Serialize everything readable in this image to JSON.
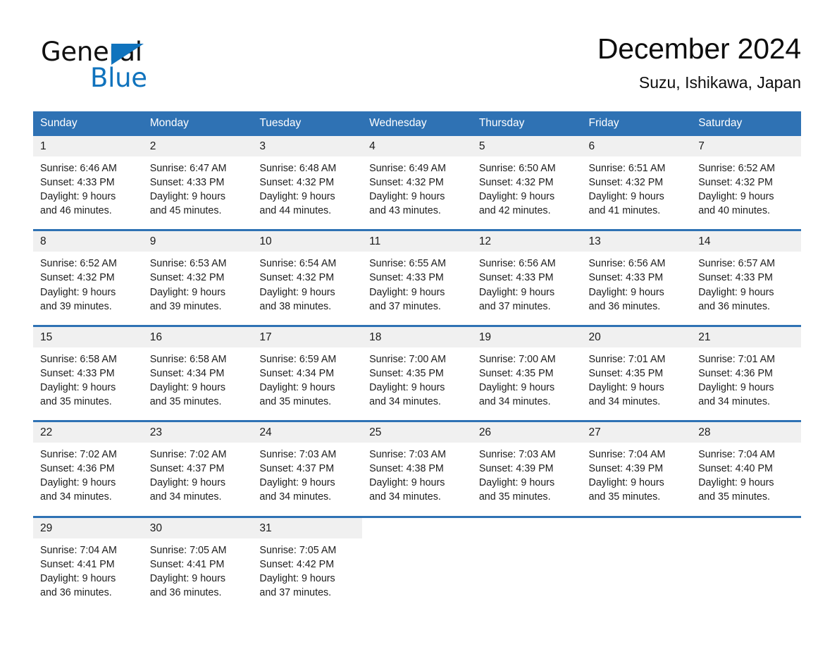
{
  "brand": {
    "word_one": "General",
    "word_two": "Blue",
    "triangle_icon": "triangle-icon",
    "colors": {
      "blue": "#1073bd",
      "black": "#101010"
    }
  },
  "header": {
    "title": "December 2024",
    "subtitle": "Suzu, Ishikawa, Japan"
  },
  "theme": {
    "header_blue": "#2f72b4",
    "daynum_gray": "#f0f0f0",
    "rule_blue": "#2f72b4"
  },
  "weekday_headers": [
    "Sunday",
    "Monday",
    "Tuesday",
    "Wednesday",
    "Thursday",
    "Friday",
    "Saturday"
  ],
  "weeks": [
    {
      "days": [
        {
          "num": "1",
          "sunrise": "Sunrise: 6:46 AM",
          "sunset": "Sunset: 4:33 PM",
          "daylight1": "Daylight: 9 hours",
          "daylight2": "and 46 minutes."
        },
        {
          "num": "2",
          "sunrise": "Sunrise: 6:47 AM",
          "sunset": "Sunset: 4:33 PM",
          "daylight1": "Daylight: 9 hours",
          "daylight2": "and 45 minutes."
        },
        {
          "num": "3",
          "sunrise": "Sunrise: 6:48 AM",
          "sunset": "Sunset: 4:32 PM",
          "daylight1": "Daylight: 9 hours",
          "daylight2": "and 44 minutes."
        },
        {
          "num": "4",
          "sunrise": "Sunrise: 6:49 AM",
          "sunset": "Sunset: 4:32 PM",
          "daylight1": "Daylight: 9 hours",
          "daylight2": "and 43 minutes."
        },
        {
          "num": "5",
          "sunrise": "Sunrise: 6:50 AM",
          "sunset": "Sunset: 4:32 PM",
          "daylight1": "Daylight: 9 hours",
          "daylight2": "and 42 minutes."
        },
        {
          "num": "6",
          "sunrise": "Sunrise: 6:51 AM",
          "sunset": "Sunset: 4:32 PM",
          "daylight1": "Daylight: 9 hours",
          "daylight2": "and 41 minutes."
        },
        {
          "num": "7",
          "sunrise": "Sunrise: 6:52 AM",
          "sunset": "Sunset: 4:32 PM",
          "daylight1": "Daylight: 9 hours",
          "daylight2": "and 40 minutes."
        }
      ]
    },
    {
      "days": [
        {
          "num": "8",
          "sunrise": "Sunrise: 6:52 AM",
          "sunset": "Sunset: 4:32 PM",
          "daylight1": "Daylight: 9 hours",
          "daylight2": "and 39 minutes."
        },
        {
          "num": "9",
          "sunrise": "Sunrise: 6:53 AM",
          "sunset": "Sunset: 4:32 PM",
          "daylight1": "Daylight: 9 hours",
          "daylight2": "and 39 minutes."
        },
        {
          "num": "10",
          "sunrise": "Sunrise: 6:54 AM",
          "sunset": "Sunset: 4:32 PM",
          "daylight1": "Daylight: 9 hours",
          "daylight2": "and 38 minutes."
        },
        {
          "num": "11",
          "sunrise": "Sunrise: 6:55 AM",
          "sunset": "Sunset: 4:33 PM",
          "daylight1": "Daylight: 9 hours",
          "daylight2": "and 37 minutes."
        },
        {
          "num": "12",
          "sunrise": "Sunrise: 6:56 AM",
          "sunset": "Sunset: 4:33 PM",
          "daylight1": "Daylight: 9 hours",
          "daylight2": "and 37 minutes."
        },
        {
          "num": "13",
          "sunrise": "Sunrise: 6:56 AM",
          "sunset": "Sunset: 4:33 PM",
          "daylight1": "Daylight: 9 hours",
          "daylight2": "and 36 minutes."
        },
        {
          "num": "14",
          "sunrise": "Sunrise: 6:57 AM",
          "sunset": "Sunset: 4:33 PM",
          "daylight1": "Daylight: 9 hours",
          "daylight2": "and 36 minutes."
        }
      ]
    },
    {
      "days": [
        {
          "num": "15",
          "sunrise": "Sunrise: 6:58 AM",
          "sunset": "Sunset: 4:33 PM",
          "daylight1": "Daylight: 9 hours",
          "daylight2": "and 35 minutes."
        },
        {
          "num": "16",
          "sunrise": "Sunrise: 6:58 AM",
          "sunset": "Sunset: 4:34 PM",
          "daylight1": "Daylight: 9 hours",
          "daylight2": "and 35 minutes."
        },
        {
          "num": "17",
          "sunrise": "Sunrise: 6:59 AM",
          "sunset": "Sunset: 4:34 PM",
          "daylight1": "Daylight: 9 hours",
          "daylight2": "and 35 minutes."
        },
        {
          "num": "18",
          "sunrise": "Sunrise: 7:00 AM",
          "sunset": "Sunset: 4:35 PM",
          "daylight1": "Daylight: 9 hours",
          "daylight2": "and 34 minutes."
        },
        {
          "num": "19",
          "sunrise": "Sunrise: 7:00 AM",
          "sunset": "Sunset: 4:35 PM",
          "daylight1": "Daylight: 9 hours",
          "daylight2": "and 34 minutes."
        },
        {
          "num": "20",
          "sunrise": "Sunrise: 7:01 AM",
          "sunset": "Sunset: 4:35 PM",
          "daylight1": "Daylight: 9 hours",
          "daylight2": "and 34 minutes."
        },
        {
          "num": "21",
          "sunrise": "Sunrise: 7:01 AM",
          "sunset": "Sunset: 4:36 PM",
          "daylight1": "Daylight: 9 hours",
          "daylight2": "and 34 minutes."
        }
      ]
    },
    {
      "days": [
        {
          "num": "22",
          "sunrise": "Sunrise: 7:02 AM",
          "sunset": "Sunset: 4:36 PM",
          "daylight1": "Daylight: 9 hours",
          "daylight2": "and 34 minutes."
        },
        {
          "num": "23",
          "sunrise": "Sunrise: 7:02 AM",
          "sunset": "Sunset: 4:37 PM",
          "daylight1": "Daylight: 9 hours",
          "daylight2": "and 34 minutes."
        },
        {
          "num": "24",
          "sunrise": "Sunrise: 7:03 AM",
          "sunset": "Sunset: 4:37 PM",
          "daylight1": "Daylight: 9 hours",
          "daylight2": "and 34 minutes."
        },
        {
          "num": "25",
          "sunrise": "Sunrise: 7:03 AM",
          "sunset": "Sunset: 4:38 PM",
          "daylight1": "Daylight: 9 hours",
          "daylight2": "and 34 minutes."
        },
        {
          "num": "26",
          "sunrise": "Sunrise: 7:03 AM",
          "sunset": "Sunset: 4:39 PM",
          "daylight1": "Daylight: 9 hours",
          "daylight2": "and 35 minutes."
        },
        {
          "num": "27",
          "sunrise": "Sunrise: 7:04 AM",
          "sunset": "Sunset: 4:39 PM",
          "daylight1": "Daylight: 9 hours",
          "daylight2": "and 35 minutes."
        },
        {
          "num": "28",
          "sunrise": "Sunrise: 7:04 AM",
          "sunset": "Sunset: 4:40 PM",
          "daylight1": "Daylight: 9 hours",
          "daylight2": "and 35 minutes."
        }
      ]
    },
    {
      "days": [
        {
          "num": "29",
          "sunrise": "Sunrise: 7:04 AM",
          "sunset": "Sunset: 4:41 PM",
          "daylight1": "Daylight: 9 hours",
          "daylight2": "and 36 minutes."
        },
        {
          "num": "30",
          "sunrise": "Sunrise: 7:05 AM",
          "sunset": "Sunset: 4:41 PM",
          "daylight1": "Daylight: 9 hours",
          "daylight2": "and 36 minutes."
        },
        {
          "num": "31",
          "sunrise": "Sunrise: 7:05 AM",
          "sunset": "Sunset: 4:42 PM",
          "daylight1": "Daylight: 9 hours",
          "daylight2": "and 37 minutes."
        },
        {
          "num": "",
          "sunrise": "",
          "sunset": "",
          "daylight1": "",
          "daylight2": ""
        },
        {
          "num": "",
          "sunrise": "",
          "sunset": "",
          "daylight1": "",
          "daylight2": ""
        },
        {
          "num": "",
          "sunrise": "",
          "sunset": "",
          "daylight1": "",
          "daylight2": ""
        },
        {
          "num": "",
          "sunrise": "",
          "sunset": "",
          "daylight1": "",
          "daylight2": ""
        }
      ]
    }
  ]
}
